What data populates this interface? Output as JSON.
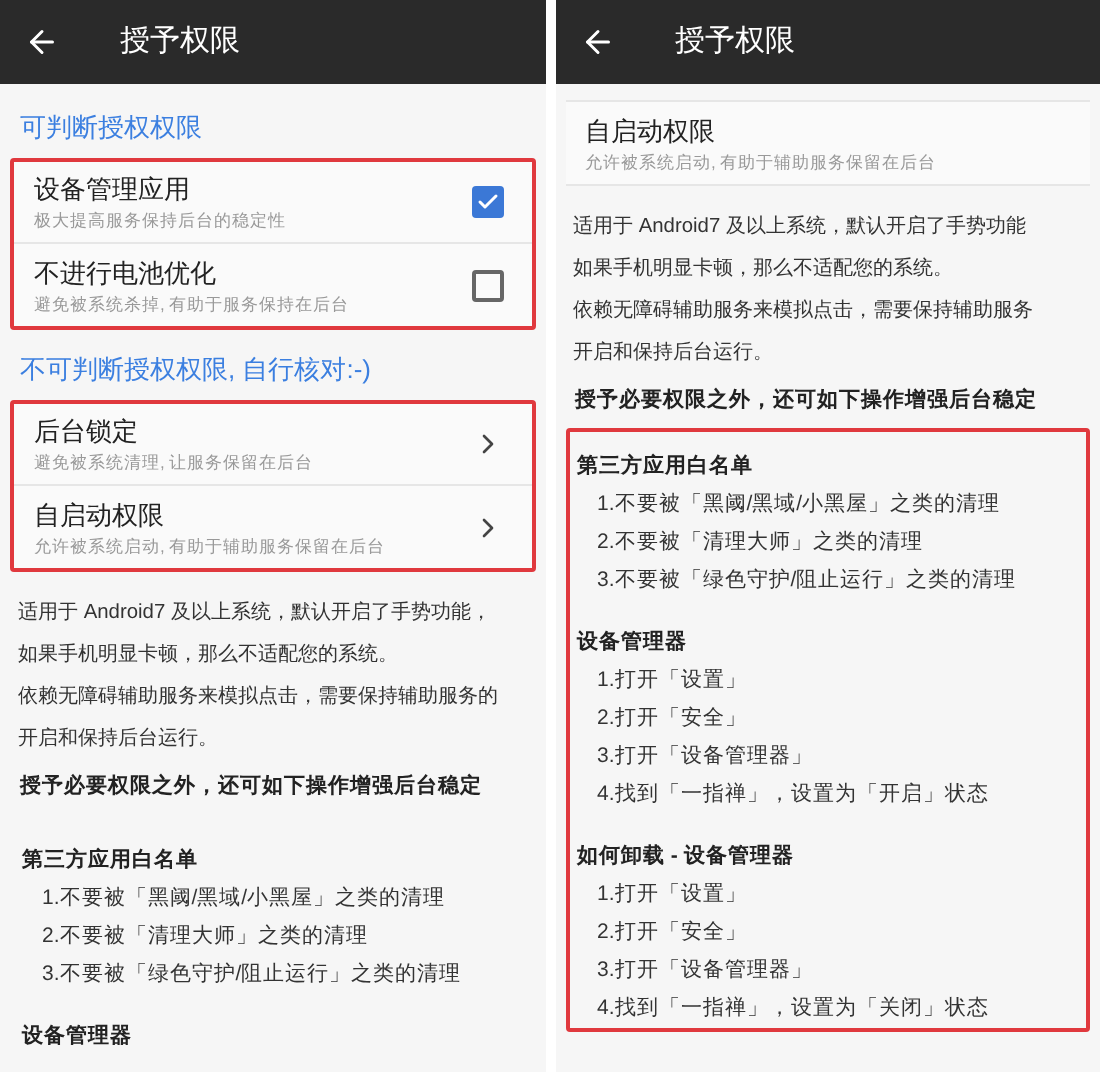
{
  "screens": [
    {
      "title": "授予权限",
      "blocks": [
        {
          "kind": "heading",
          "text": "可判断授权权限"
        },
        {
          "kind": "settings_group",
          "highlighted": true,
          "items": [
            {
              "kind": "checkbox",
              "title": "设备管理应用",
              "subtitle": "极大提高服务保持后台的稳定性",
              "checked": true
            },
            {
              "kind": "checkbox",
              "title": "不进行电池优化",
              "subtitle": "避免被系统杀掉, 有助于服务保持在后台",
              "checked": false
            }
          ]
        },
        {
          "kind": "heading",
          "text": "不可判断授权权限, 自行核对:-)"
        },
        {
          "kind": "settings_group",
          "highlighted": true,
          "items": [
            {
              "kind": "chevron",
              "title": "后台锁定",
              "subtitle": "避免被系统清理, 让服务保留在后台"
            },
            {
              "kind": "chevron",
              "title": "自启动权限",
              "subtitle": "允许被系统启动, 有助于辅助服务保留在后台"
            }
          ]
        },
        {
          "kind": "text_lines",
          "lines": [
            "适用于 Android7 及以上系统，默认开启了手势功能，",
            "如果手机明显卡顿，那么不适配您的系统。",
            "依赖无障碍辅助服务来模拟点击，需要保持辅助服务的",
            "开启和保持后台运行。"
          ]
        },
        {
          "kind": "bold_text",
          "text": "授予必要权限之外，还可如下操作增强后台稳定"
        },
        {
          "kind": "guide",
          "groups": [
            {
              "title": "第三方应用白名单",
              "steps": [
                "1.不要被「黑阈/黑域/小黑屋」之类的清理",
                "2.不要被「清理大师」之类的清理",
                "3.不要被「绿色守护/阻止运行」之类的清理"
              ]
            },
            {
              "title": "设备管理器"
            }
          ]
        }
      ]
    },
    {
      "title": "授予权限",
      "blocks": [
        {
          "kind": "settings_group",
          "highlighted": false,
          "items": [
            {
              "kind": "plain",
              "title": "自启动权限",
              "subtitle": "允许被系统启动, 有助于辅助服务保留在后台"
            }
          ]
        },
        {
          "kind": "text_lines",
          "lines": [
            "适用于 Android7 及以上系统，默认开启了手势功能",
            "如果手机明显卡顿，那么不适配您的系统。",
            "依赖无障碍辅助服务来模拟点击，需要保持辅助服务",
            "开启和保持后台运行。"
          ]
        },
        {
          "kind": "bold_text",
          "text": "授予必要权限之外，还可如下操作增强后台稳定"
        },
        {
          "kind": "guide",
          "highlighted": true,
          "groups": [
            {
              "title": "第三方应用白名单",
              "steps": [
                "1.不要被「黑阈/黑域/小黑屋」之类的清理",
                "2.不要被「清理大师」之类的清理",
                "3.不要被「绿色守护/阻止运行」之类的清理"
              ]
            },
            {
              "title": "设备管理器",
              "steps": [
                "1.打开「设置」",
                "2.打开「安全」",
                "3.打开「设备管理器」",
                "4.找到「一指禅」，设置为「开启」状态"
              ]
            },
            {
              "title": "如何卸载 - 设备管理器",
              "steps": [
                "1.打开「设置」",
                "2.打开「安全」",
                "3.打开「设备管理器」",
                "4.找到「一指禅」，设置为「关闭」状态"
              ]
            }
          ]
        }
      ]
    }
  ]
}
